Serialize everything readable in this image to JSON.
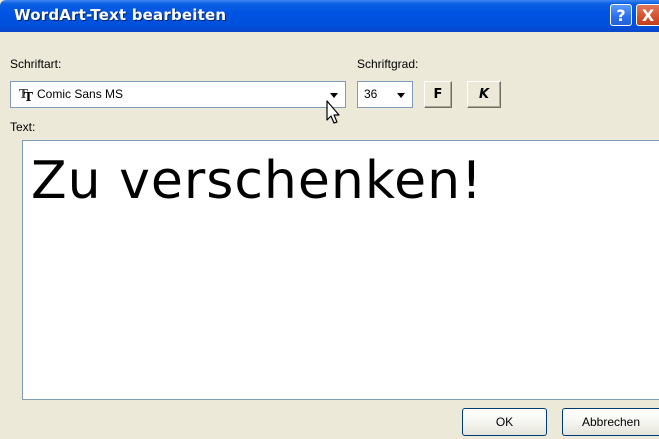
{
  "window": {
    "title": "WordArt-Text bearbeiten"
  },
  "titlebar_buttons": {
    "help": "?",
    "close": "X"
  },
  "font": {
    "label": "Schriftart:",
    "icon": "truetype-font-icon",
    "value": "Comic Sans MS"
  },
  "size": {
    "label": "Schriftgrad:",
    "value": "36"
  },
  "style_buttons": {
    "bold": "F",
    "italic": "K"
  },
  "text": {
    "label": "Text:",
    "value": "Zu verschenken!"
  },
  "buttons": {
    "ok": "OK",
    "cancel": "Abbrechen"
  },
  "colors": {
    "titlebar": "#0054e3",
    "dialog_bg": "#ece9d8",
    "field_border": "#7f9db9"
  }
}
